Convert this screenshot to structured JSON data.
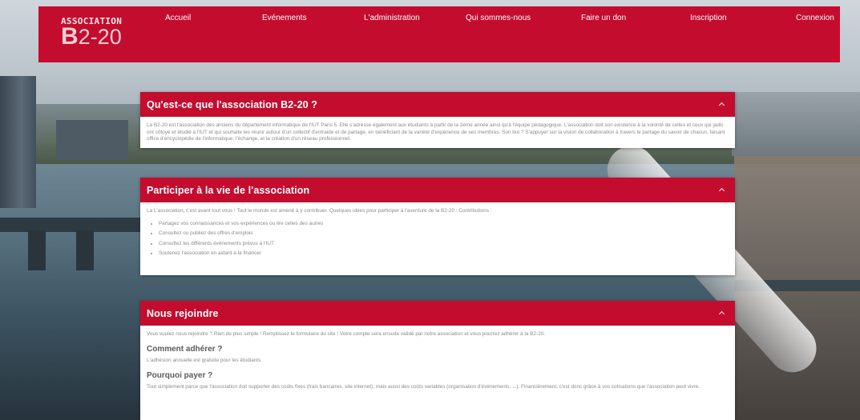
{
  "header": {
    "logo_top": "ASSOCIATION",
    "logo_b": "B",
    "logo_rest": "2-20",
    "accent_color": "#c40c2e"
  },
  "nav": {
    "items": [
      {
        "label": "Accueil"
      },
      {
        "label": "Evénements"
      },
      {
        "label": "L'administration"
      },
      {
        "label": "Qui sommes-nous"
      },
      {
        "label": "Faire un don"
      },
      {
        "label": "Inscription"
      },
      {
        "label": "Connexion"
      }
    ]
  },
  "panels": [
    {
      "title": "Qu'est-ce que l'association B2-20 ?",
      "body": "La B2-20 est l'association des anciens du département informatique de l'IUT Paris 5. Elle s'adresse également aux étudiants à partir de la 2ème année ainsi qu'à l'équipe pédagogique. L'association doit son existence à la volonté de celles et ceux qui jadis ont côtoyé et étudié à l'IUT et qui souhaite les réunir autour d'un collectif d'entraide et de partage, en bénéficiant de la variété d'expérience de ses membres. Son but ? S'appuyer sur la vision de collaboration à travers le partage du savoir de chacun, faisant office d'encyclopédie de l'informatique, l'échange, et la création d'un réseau professionnel."
    },
    {
      "title": "Participer à la vie de l'association",
      "intro": "La L'association, c'est avant tout vous ! Tout le monde est amené à y contribuer. Quelques idées pour participer à l'aventure de la B2-20 : Contributions :",
      "items": [
        "Partagez vos connaissances et vos expériences ou lire celles des autres",
        "Consultez ou publiez des offres d'emplois",
        "Consultez les différents évènements prévus à l'IUT",
        "Soutenez l'association en aidant à la financer"
      ]
    },
    {
      "title": "Nous rejoindre",
      "intro": "Vous voulez nous rejoindre ? Rien de plus simple ! Remplissez le formulaire du site ! Votre compte sera ensuite validé par notre association et vous pourrez adhérer à la B2-20.",
      "h1": "Comment adhérer ?",
      "p1": "L'adhésion annuelle est gratuite pour les étudiants",
      "h2": "Pourquoi payer ?",
      "p2": "Tout simplement parce que l'association doit supporter des coûts fixes (frais bancaires, site internet), mais aussi des coûts variables (organisation d'évènements, ...). Financièrement, c'est donc grâce à vos cotisations que l'association peut vivre."
    }
  ]
}
